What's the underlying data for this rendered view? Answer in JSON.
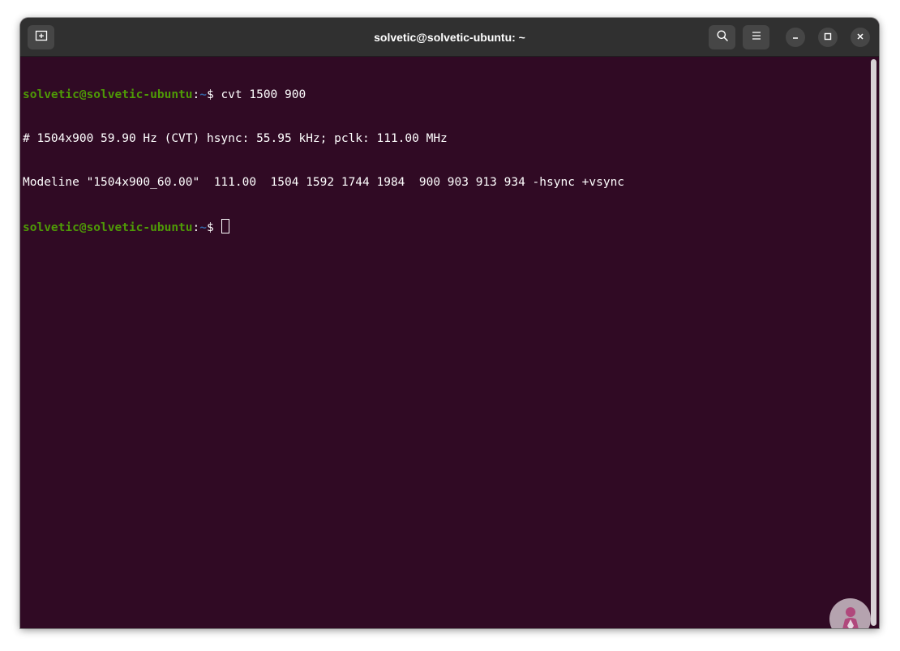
{
  "window": {
    "title": "solvetic@solvetic-ubuntu: ~"
  },
  "toolbar": {
    "new_tab_icon": "new-tab-icon",
    "search_icon": "search-icon",
    "menu_icon": "hamburger-menu-icon",
    "minimize_icon": "minimize-icon",
    "maximize_icon": "maximize-icon",
    "close_icon": "close-icon"
  },
  "terminal": {
    "lines": [
      {
        "type": "command",
        "user": "solvetic@solvetic-ubuntu",
        "colon": ":",
        "path": "~",
        "symbol": "$ ",
        "command": "cvt 1500 900"
      },
      {
        "type": "output",
        "text": "# 1504x900 59.90 Hz (CVT) hsync: 55.95 kHz; pclk: 111.00 MHz"
      },
      {
        "type": "output",
        "text": "Modeline \"1504x900_60.00\"  111.00  1504 1592 1744 1984  900 903 913 934 -hsync +vsync"
      },
      {
        "type": "prompt",
        "user": "solvetic@solvetic-ubuntu",
        "colon": ":",
        "path": "~",
        "symbol": "$ ",
        "command": ""
      }
    ]
  },
  "colors": {
    "terminal_bg": "#300a24",
    "titlebar_bg": "#303030",
    "prompt_user": "#4e9a06",
    "prompt_path": "#3465a4",
    "text": "#ffffff"
  },
  "watermark": {
    "icon": "solvetic-logo-icon"
  }
}
